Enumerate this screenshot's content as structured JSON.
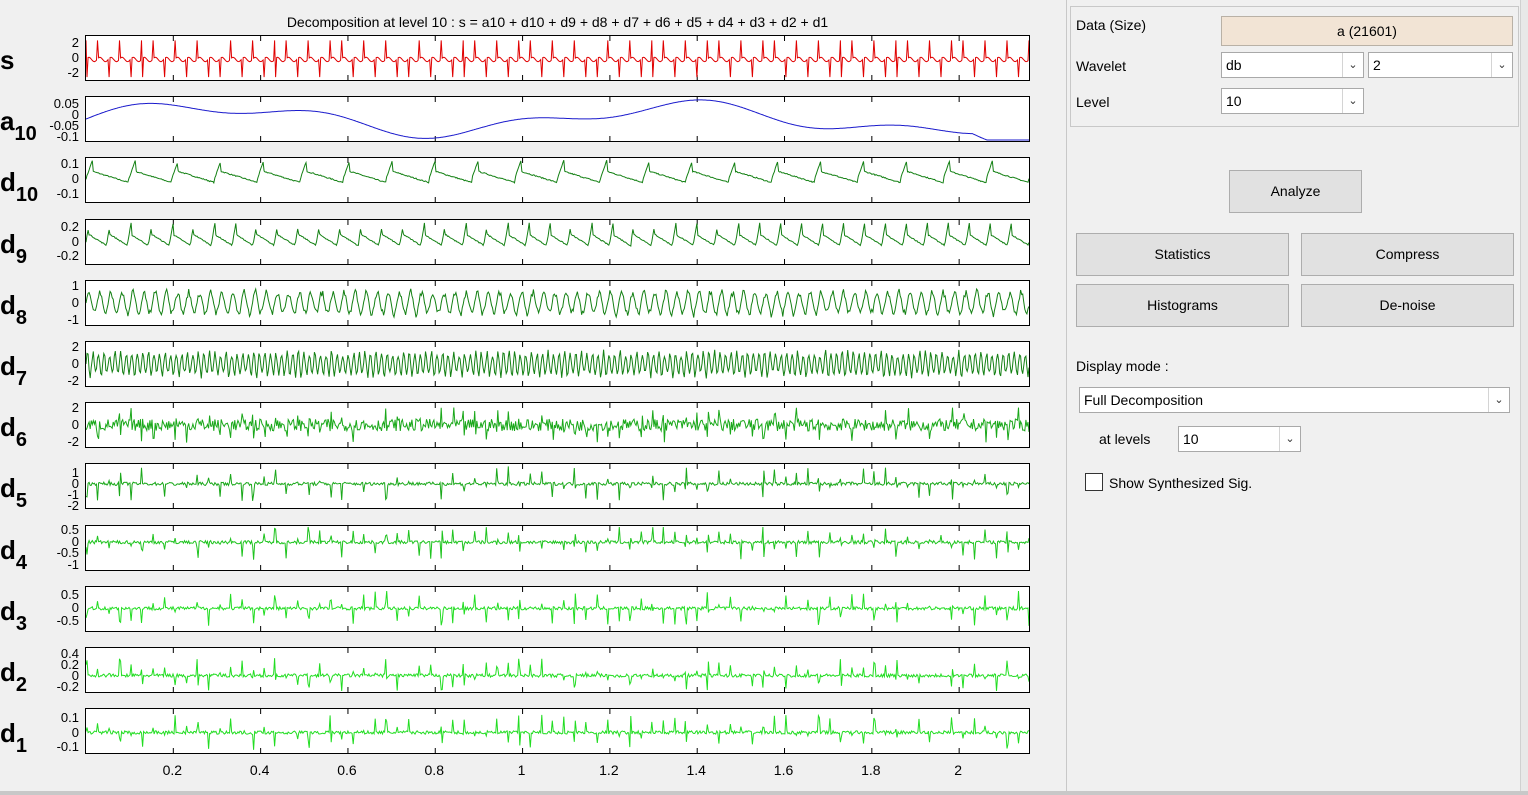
{
  "plot": {
    "title": "Decomposition at level 10 : s = a10 + d10 + d9 + d8 + d7 + d6 + d5 + d4 + d3 + d2 + d1",
    "x_ticks": [
      "0.2",
      "0.4",
      "0.6",
      "0.8",
      "1",
      "1.2",
      "1.4",
      "1.6",
      "1.8",
      "2"
    ],
    "colors": {
      "signal": "#e00000",
      "approx": "#1a1acc",
      "detail_dark": "#138013",
      "detail_mid": "#1aa81a",
      "detail_bright": "#22dd22"
    }
  },
  "chart_data": {
    "type": "line",
    "title": "Decomposition at level 10 : s = a10 + d10 + d9 + d8 + d7 + d6 + d5 + d4 + d3 + d2 + d1",
    "x_ticks": [
      0.2,
      0.4,
      0.6,
      0.8,
      1,
      1.2,
      1.4,
      1.6,
      1.8,
      2
    ],
    "xlim": [
      0,
      2.16
    ],
    "series": [
      {
        "name": "s",
        "sub": "",
        "color": "#e00000",
        "ylim": [
          -3,
          3
        ],
        "yticks": [
          "2",
          "0",
          "-2"
        ],
        "cycles": 85,
        "kind": "ecg"
      },
      {
        "name": "a",
        "sub": "10",
        "color": "#1a1acc",
        "ylim": [
          -0.12,
          0.08
        ],
        "yticks": [
          "0.05",
          "0",
          "-0.05",
          "-0.1"
        ],
        "cycles": 0,
        "kind": "approx"
      },
      {
        "name": "d",
        "sub": "10",
        "color": "#138013",
        "ylim": [
          -0.16,
          0.14
        ],
        "yticks": [
          "0.1",
          "0",
          "-0.1"
        ],
        "cycles": 22,
        "kind": "saw"
      },
      {
        "name": "d",
        "sub": "9",
        "color": "#138013",
        "ylim": [
          -0.3,
          0.3
        ],
        "yticks": [
          "0.2",
          "0",
          "-0.2"
        ],
        "cycles": 45,
        "kind": "saw"
      },
      {
        "name": "d",
        "sub": "8",
        "color": "#138013",
        "ylim": [
          -1.3,
          1.3
        ],
        "yticks": [
          "1",
          "0",
          "-1"
        ],
        "cycles": 85,
        "kind": "spiky"
      },
      {
        "name": "d",
        "sub": "7",
        "color": "#138013",
        "ylim": [
          -2.6,
          2.6
        ],
        "yticks": [
          "2",
          "0",
          "-2"
        ],
        "cycles": 170,
        "kind": "spiky"
      },
      {
        "name": "d",
        "sub": "6",
        "color": "#1aa81a",
        "ylim": [
          -2.6,
          2.6
        ],
        "yticks": [
          "2",
          "0",
          "-2"
        ],
        "cycles": 300,
        "kind": "burst"
      },
      {
        "name": "d",
        "sub": "5",
        "color": "#1aa81a",
        "ylim": [
          -2.2,
          1.8
        ],
        "yticks": [
          "1",
          "0",
          "-1",
          "-2"
        ],
        "cycles": 85,
        "kind": "pulse"
      },
      {
        "name": "d",
        "sub": "4",
        "color": "#1fc41f",
        "ylim": [
          -1.2,
          0.7
        ],
        "yticks": [
          "0.5",
          "0",
          "-0.5",
          "-1"
        ],
        "cycles": 85,
        "kind": "pulse"
      },
      {
        "name": "d",
        "sub": "3",
        "color": "#22dd22",
        "ylim": [
          -0.85,
          0.8
        ],
        "yticks": [
          "0.5",
          "0",
          "-0.5"
        ],
        "cycles": 85,
        "kind": "pulse"
      },
      {
        "name": "d",
        "sub": "2",
        "color": "#22dd22",
        "ylim": [
          -0.3,
          0.5
        ],
        "yticks": [
          "0.4",
          "0.2",
          "0",
          "-0.2"
        ],
        "cycles": 85,
        "kind": "pulse"
      },
      {
        "name": "d",
        "sub": "1",
        "color": "#22dd22",
        "ylim": [
          -0.14,
          0.16
        ],
        "yticks": [
          "0.1",
          "0",
          "-0.1"
        ],
        "cycles": 85,
        "kind": "pulse"
      }
    ]
  },
  "panel": {
    "data_label": "Data  (Size)",
    "data_value": "a  (21601)",
    "wavelet_label": "Wavelet",
    "wavelet_family": "db",
    "wavelet_order": "2",
    "level_label": "Level",
    "level_value": "10",
    "analyze": "Analyze",
    "statistics": "Statistics",
    "compress": "Compress",
    "histograms": "Histograms",
    "denoise": "De-noise",
    "display_mode_label": "Display mode :",
    "display_mode_value": "Full Decomposition",
    "at_levels_label": "at levels",
    "at_levels_value": "10",
    "show_synth_label": "Show Synthesized Sig.",
    "show_synth_checked": false
  }
}
